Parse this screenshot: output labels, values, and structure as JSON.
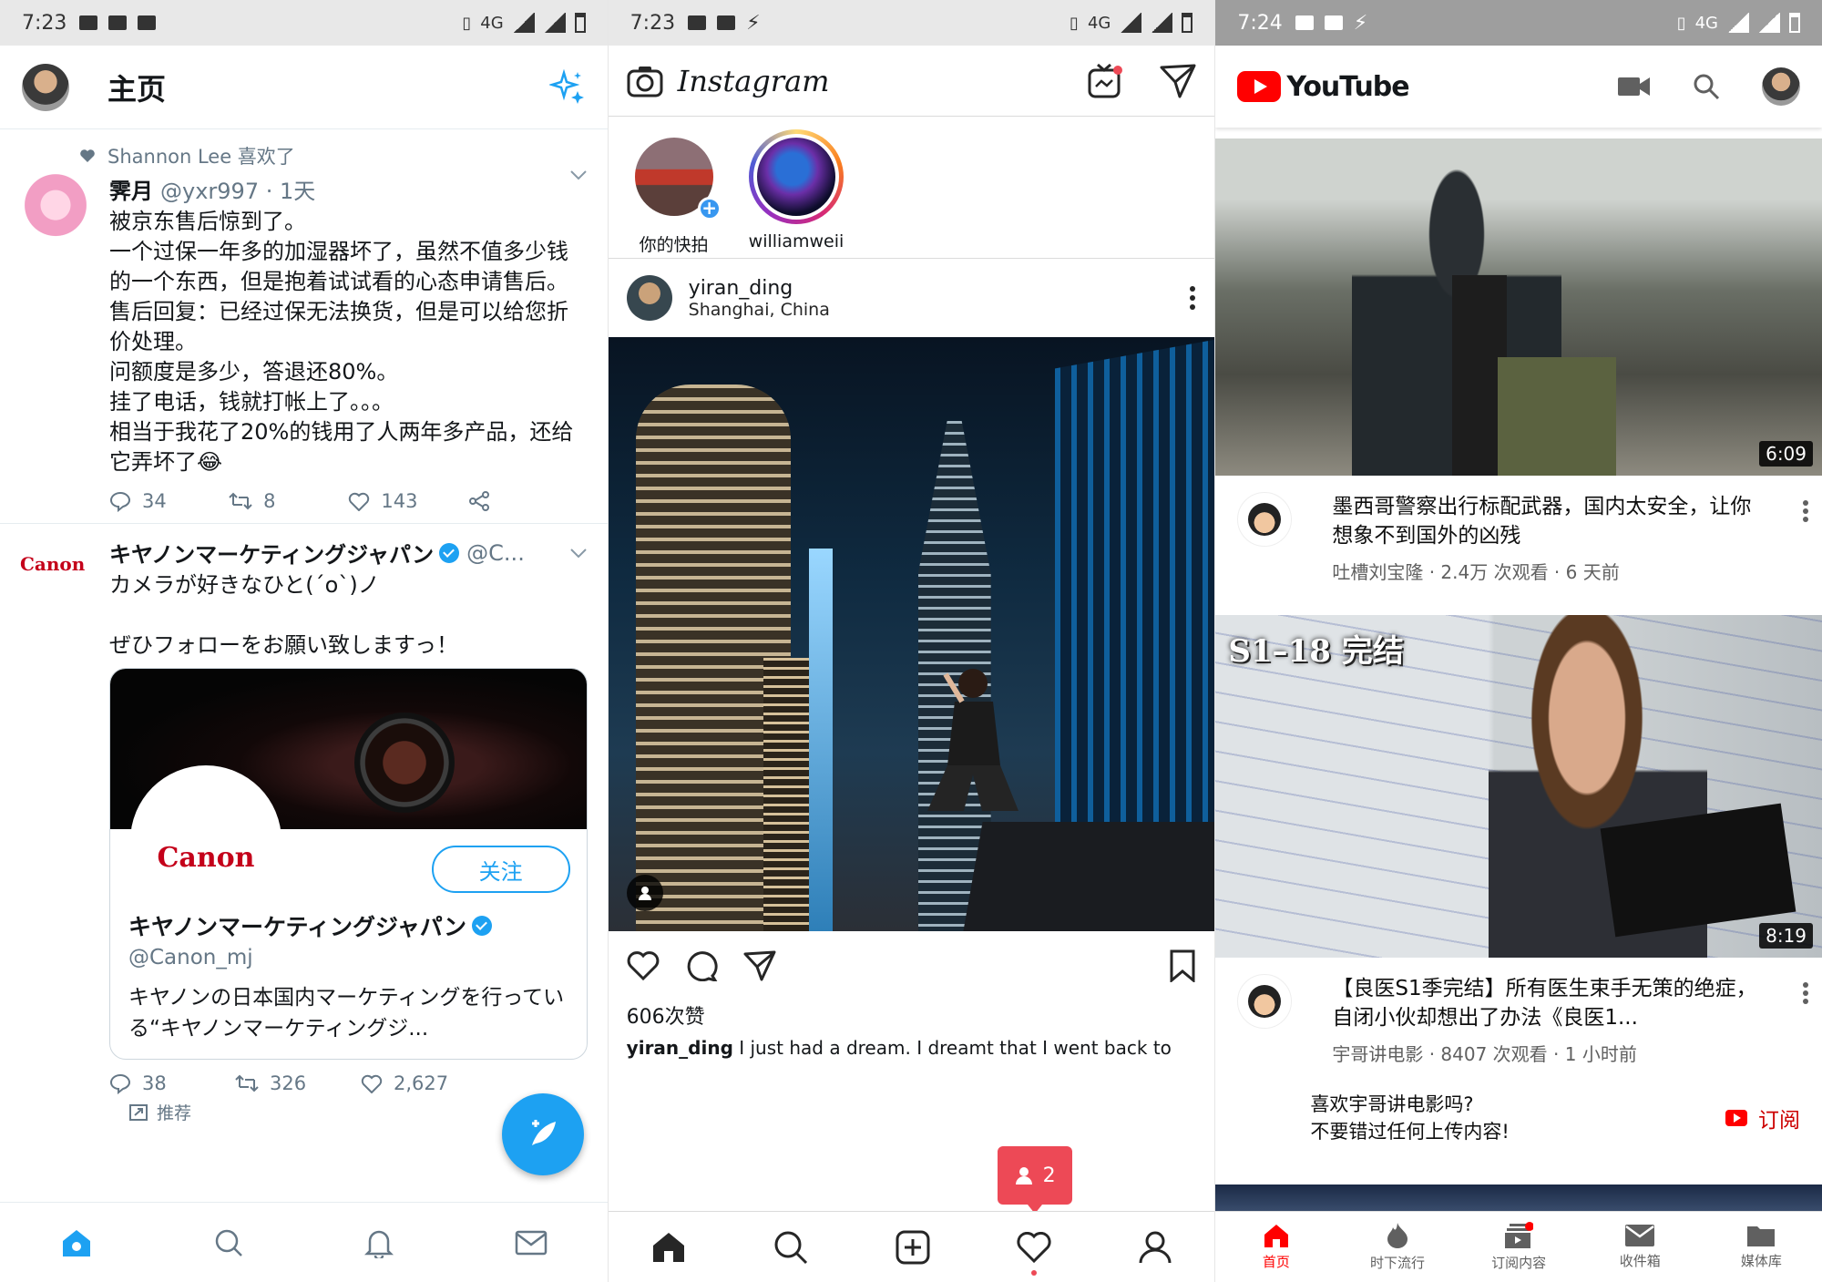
{
  "twitter": {
    "status": {
      "time": "7:23",
      "net": "4G"
    },
    "header": {
      "title": "主页"
    },
    "tweet1": {
      "social_context": "Shannon Lee 喜欢了",
      "name": "霁月",
      "handle": "@yxr997 · 1天",
      "text": "被京东售后惊到了。\n一个过保一年多的加湿器坏了，虽然不值多少钱的一个东西，但是抱着试试看的心态申请售后。\n售后回复：已经过保无法换货，但是可以给您折价处理。\n问额度是多少，答退还80%。\n挂了电话，钱就打帐上了。。。\n相当于我花了20%的钱用了人两年多产品，还给它弄坏了😂",
      "replies": "34",
      "retweets": "8",
      "likes": "143"
    },
    "tweet2": {
      "logo_text": "Canon",
      "name": "キヤノンマーケティングジャパン",
      "handle": "@C...",
      "text": "カメラが好きなひと(´o`)ノ\n\nぜひフォローをお願い致しますっ！",
      "card": {
        "logo_text": "Canon",
        "follow_label": "关注",
        "name": "キヤノンマーケティングジャパン",
        "handle": "@Canon_mj",
        "desc": "キヤノンの日本国内マーケティングを行っている“キヤノンマーケティングジ..."
      },
      "replies": "38",
      "retweets": "326",
      "likes": "2,627",
      "promoted": "推荐"
    },
    "colors": {
      "accent": "#1da1f2"
    }
  },
  "instagram": {
    "status": {
      "time": "7:23",
      "net": "4G"
    },
    "header": {
      "logo": "Instagram"
    },
    "stories": [
      {
        "label": "你的快拍"
      },
      {
        "label": "williamweii"
      }
    ],
    "post": {
      "user": "yiran_ding",
      "location": "Shanghai, China",
      "likes": "606次赞",
      "caption_user": "yiran_ding",
      "caption_text": " I just had a dream. I dreamt that I went back to"
    },
    "activity_badge": "2",
    "colors": {
      "badge": "#ed4956"
    }
  },
  "youtube": {
    "status": {
      "time": "7:24",
      "net": "4G"
    },
    "header": {
      "logo": "YouTube"
    },
    "videos": [
      {
        "title": "墨西哥警察出行标配武器，国内太安全，让你想象不到国外的凶残",
        "meta": "吐槽刘宝隆 · 2.4万 次观看 · 6 天前",
        "duration": "6:09"
      },
      {
        "overlay": "S1–18 完结",
        "title": "【良医S1季完结】所有医生束手无策的绝症，自闭小伙却想出了办法《良医1...",
        "meta": "宇哥讲电影 · 8407 次观看 · 1 小时前",
        "duration": "8:19"
      }
    ],
    "promo": {
      "line1": "喜欢宇哥讲电影吗?",
      "line2": "不要错过任何上传内容!",
      "subscribe": "订阅"
    },
    "nav": [
      "首页",
      "时下流行",
      "订阅内容",
      "收件箱",
      "媒体库"
    ],
    "colors": {
      "brand": "#ff0000"
    }
  }
}
